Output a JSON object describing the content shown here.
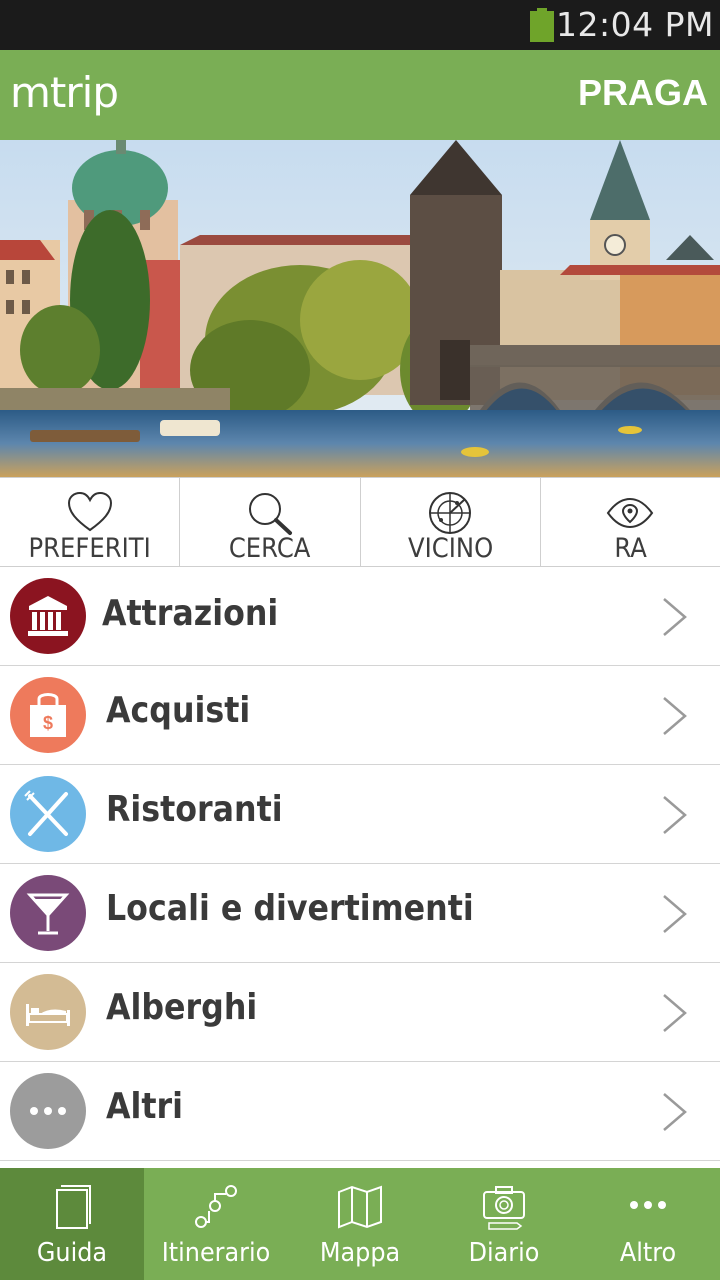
{
  "status_bar": {
    "time": "12:04 PM",
    "battery_color": "#6fa42a"
  },
  "header": {
    "logo": "mtrip",
    "city": "PRAGA",
    "color": "#7aae55"
  },
  "quick_tools": [
    {
      "label": "PREFERITI",
      "icon": "heart-icon"
    },
    {
      "label": "CERCA",
      "icon": "search-icon"
    },
    {
      "label": "VICINO",
      "icon": "radar-icon"
    },
    {
      "label": "RA",
      "icon": "eye-location-icon"
    }
  ],
  "categories": [
    {
      "label": "Attrazioni",
      "icon": "museum-icon",
      "color": "#8b1420"
    },
    {
      "label": "Acquisti",
      "icon": "shopping-bag-icon",
      "color": "#ee7a5c"
    },
    {
      "label": "Ristoranti",
      "icon": "fork-knife-icon",
      "color": "#6fb8e6"
    },
    {
      "label": "Locali e divertimenti",
      "icon": "cocktail-icon",
      "color": "#7a4a78"
    },
    {
      "label": "Alberghi",
      "icon": "bed-icon",
      "color": "#d3bb94"
    },
    {
      "label": "Altri",
      "icon": "more-icon",
      "color": "#9c9c9c"
    }
  ],
  "tabs": [
    {
      "label": "Guida",
      "icon": "book-icon",
      "active": true
    },
    {
      "label": "Itinerario",
      "icon": "route-icon",
      "active": false
    },
    {
      "label": "Mappa",
      "icon": "map-icon",
      "active": false
    },
    {
      "label": "Diario",
      "icon": "camera-icon",
      "active": false
    },
    {
      "label": "Altro",
      "icon": "more-icon",
      "active": false
    }
  ]
}
